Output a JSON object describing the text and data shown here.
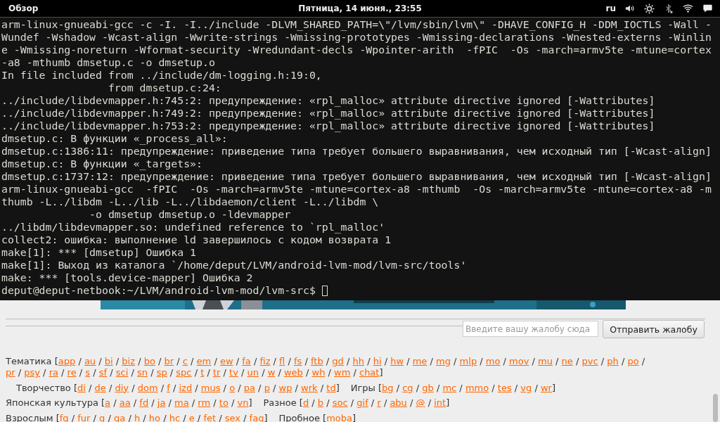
{
  "top_bar": {
    "activities": "Обзор",
    "clock": "Пятница, 14 июня., 23:55",
    "keyboard_layout": "ru"
  },
  "terminal": {
    "lines": [
      "arm-linux-gnueabi-gcc -c -I. -I../include -DLVM_SHARED_PATH=\\\"/lvm/sbin/lvm\\\" -DHAVE_CONFIG_H -DDM_IOCTLS -Wall -",
      "Wundef -Wshadow -Wcast-align -Wwrite-strings -Wmissing-prototypes -Wmissing-declarations -Wnested-externs -Winlin",
      "e -Wmissing-noreturn -Wformat-security -Wredundant-decls -Wpointer-arith  -fPIC  -Os -march=armv5te -mtune=cortex",
      "-a8 -mthumb dmsetup.c -o dmsetup.o",
      "In file included from ../include/dm-logging.h:19:0,",
      "                 from dmsetup.c:24:",
      "../include/libdevmapper.h:745:2: предупреждение: «rpl_malloc» attribute directive ignored [-Wattributes]",
      "../include/libdevmapper.h:749:2: предупреждение: «rpl_malloc» attribute directive ignored [-Wattributes]",
      "../include/libdevmapper.h:753:2: предупреждение: «rpl_malloc» attribute directive ignored [-Wattributes]",
      "dmsetup.c: В функции «_process_all»:",
      "dmsetup.c:1386:11: предупреждение: приведение типа требует большего выравнивания, чем исходный тип [-Wcast-align]",
      "dmsetup.c: В функции «_targets»:",
      "dmsetup.c:1737:12: предупреждение: приведение типа требует большего выравнивания, чем исходный тип [-Wcast-align]",
      "arm-linux-gnueabi-gcc  -fPIC  -Os -march=armv5te -mtune=cortex-a8 -mthumb  -Os -march=armv5te -mtune=cortex-a8 -m",
      "thumb -L../libdm -L../lib -L../libdaemon/client -L../libdm \\",
      "              -o dmsetup dmsetup.o -ldevmapper",
      "../libdm/libdevmapper.so: undefined reference to `rpl_malloc'",
      "collect2: ошибка: выполнение ld завершилось с кодом возврата 1",
      "make[1]: *** [dmsetup] Ошибка 1",
      "make[1]: Выход из каталога `/home/deput/LVM/android-lvm-mod/lvm-src/tools'",
      "make: *** [tools.device-mapper] Ошибка 2",
      "deput@deput-netbook:~/LVM/android-lvm-mod/lvm-src$ "
    ]
  },
  "complaint": {
    "placeholder": "Введите вашу жалобу сюда",
    "button": "Отправить жалобу"
  },
  "nav": {
    "open": "[",
    "close": "]",
    "separator": "/",
    "rows": [
      {
        "indent": false,
        "sections": [
          {
            "label": "Тематика",
            "links": [
              "app",
              "au",
              "bi",
              "biz",
              "bo",
              "br",
              "c",
              "em",
              "ew",
              "fa",
              "fiz",
              "fl",
              "fs",
              "ftb",
              "gd",
              "hh",
              "hi",
              "hw",
              "me",
              "mg",
              "mlp",
              "mo",
              "mov",
              "mu",
              "ne",
              "pvc",
              "ph",
              "po",
              "pr",
              "psy",
              "ra",
              "re",
              "s",
              "sf",
              "sci",
              "sn",
              "sp",
              "spc",
              "t",
              "tr",
              "tv",
              "un",
              "w",
              "web",
              "wh",
              "wm",
              "chat"
            ]
          }
        ]
      },
      {
        "indent": true,
        "sections": [
          {
            "label": "Творчество",
            "links": [
              "di",
              "de",
              "diy",
              "dom",
              "f",
              "izd",
              "mus",
              "o",
              "pa",
              "p",
              "wp",
              "wrk",
              "td"
            ]
          },
          {
            "label": "Игры",
            "links": [
              "bg",
              "cg",
              "gb",
              "mc",
              "mmo",
              "tes",
              "vg",
              "wr"
            ]
          }
        ]
      },
      {
        "indent": false,
        "sections": [
          {
            "label": "Японская культура",
            "links": [
              "a",
              "aa",
              "fd",
              "ja",
              "ma",
              "rm",
              "to",
              "vn"
            ]
          },
          {
            "label": "Разное",
            "links": [
              "d",
              "b",
              "soc",
              "gif",
              "r",
              "abu",
              "@",
              "int"
            ]
          }
        ]
      },
      {
        "indent": false,
        "sections": [
          {
            "label": "Взрослым",
            "links": [
              "fg",
              "fur",
              "g",
              "ga",
              "h",
              "ho",
              "hc",
              "e",
              "fet",
              "sex",
              "fag"
            ]
          },
          {
            "label": "Пробное",
            "links": [
              "moba"
            ]
          }
        ]
      }
    ]
  }
}
